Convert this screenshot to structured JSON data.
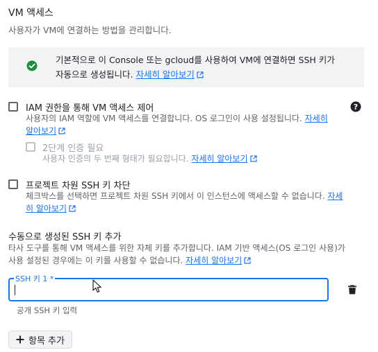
{
  "header": {
    "title": "VM 액세스",
    "subtitle": "사용자가 VM에 연결하는 방법을 관리합니다."
  },
  "notice": {
    "icon": "check-circle-icon",
    "line1": "기본적으로 이 Console 또는 gcloud를 사용하여 VM에 연결하면 SSH 키가",
    "line2": "자동으로 생성됩니다.",
    "link": "자세히 알아보기"
  },
  "iam_option": {
    "checked": false,
    "label": "IAM 권한을 통해 VM 액세스 제어",
    "desc1": "사용자의 IAM 역할에 VM 액세스를 연결합니다. OS 로그인이 사용 설정됩니다.",
    "link1": "자세히",
    "link2": "알아보기",
    "help_icon": "help-icon"
  },
  "two_factor_option": {
    "checked": false,
    "enabled": false,
    "label": "2단계 인증 필요",
    "desc": "사용자 인증의 두 번째 형태가 필요합니다.",
    "link": "자세히 알아보기"
  },
  "block_project_keys": {
    "checked": false,
    "label": "프로젝트 차원 SSH 키 차단",
    "desc1": "체크박스를 선택하면 프로젝트 차원 SSH 키에서 이 인스턴스에 액세스할 수 없습니다.",
    "link1": "자세",
    "link2": "히 알아보기"
  },
  "manual_keys": {
    "title": "수동으로 생성된 SSH 키 추가",
    "desc1": "타사 도구를 통해 VM 액세스를 위한 자체 키를 추가합니다. IAM 기반 액세스(OS 로그인 사용)가",
    "desc2": "사용 설정된 경우에는 이 키를 사용할 수 없습니다.",
    "link": "자세히 알아보기",
    "field_label": "SSH 키 1 *",
    "field_value": "",
    "field_hint": "공개 SSH 키 입력",
    "delete_icon": "trash-icon",
    "add_button": "항목 추가",
    "add_icon": "plus-icon"
  },
  "colors": {
    "accent": "#1a73e8",
    "success": "#1e8e3e",
    "note_bg": "#f1f3f4"
  }
}
